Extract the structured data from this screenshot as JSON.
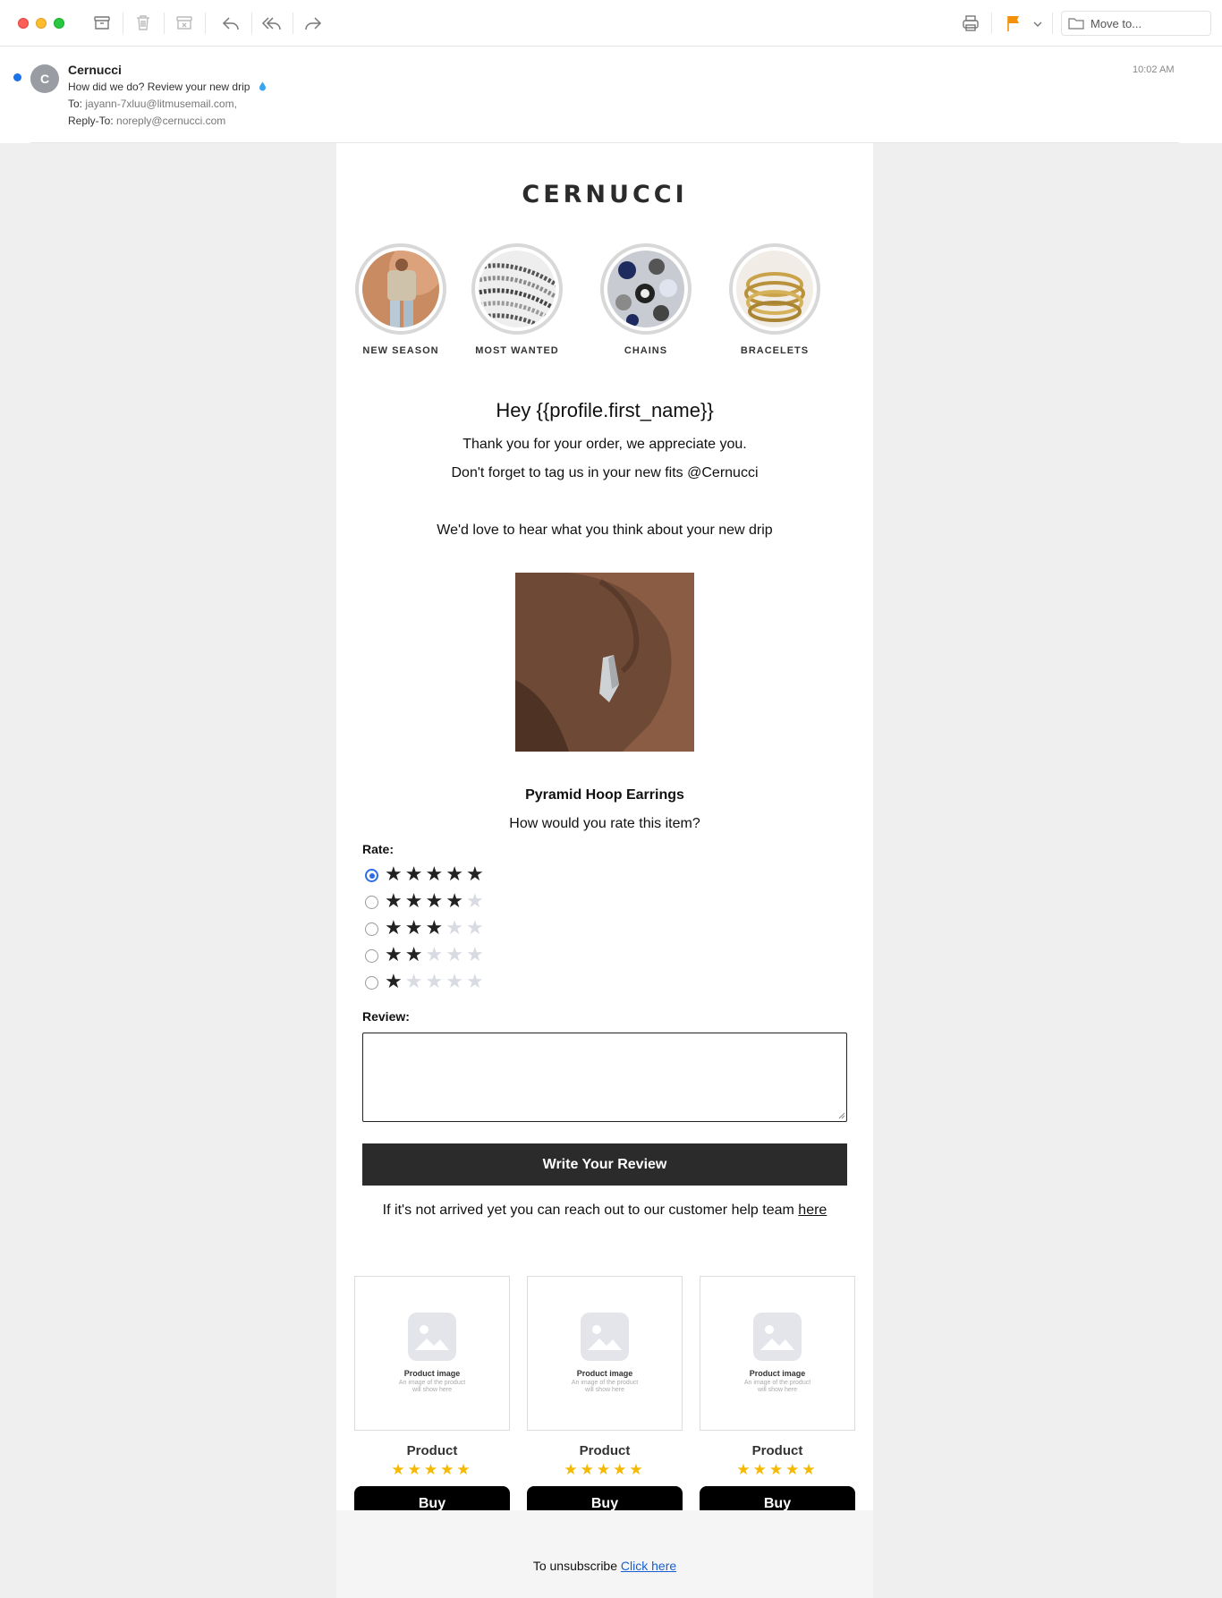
{
  "toolbar": {
    "move_to_label": "Move to...",
    "icons": [
      "archive-icon",
      "trash-icon",
      "junk-icon",
      "reply-icon",
      "reply-all-icon",
      "forward-icon",
      "print-icon",
      "flag-icon",
      "chevron-down-icon",
      "folder-icon"
    ],
    "flag_color": "#f5900b"
  },
  "message": {
    "avatar_initial": "C",
    "sender": "Cernucci",
    "subject": "How did we do? Review your new drip",
    "to_label": "To:",
    "to_value": "jayann-7xluu@litmusemail.com,",
    "reply_to_label": "Reply-To:",
    "reply_to_value": "noreply@cernucci.com",
    "time": "10:02 AM",
    "unread_color": "#1a73e8"
  },
  "email": {
    "brand": "CERNUCCI",
    "categories": [
      {
        "label": "NEW SEASON"
      },
      {
        "label": "MOST WANTED"
      },
      {
        "label": "CHAINS"
      },
      {
        "label": "BRACELETS"
      }
    ],
    "greeting": "Hey {{profile.first_name}}",
    "thanks": "Thank you for your order, we appreciate you.",
    "tag_line": "Don't forget to tag us in your new fits @Cernucci",
    "love_line": "We'd love to hear what you think about your new drip",
    "product_name": "Pyramid Hoop Earrings",
    "rate_question": "How would you rate this item?",
    "rate_label": "Rate:",
    "rating_options": [
      {
        "stars": 5,
        "selected": true
      },
      {
        "stars": 4,
        "selected": false
      },
      {
        "stars": 3,
        "selected": false
      },
      {
        "stars": 2,
        "selected": false
      },
      {
        "stars": 1,
        "selected": false
      }
    ],
    "review_label": "Review:",
    "review_value": "",
    "write_button": "Write Your Review",
    "help_text": "If it's not arrived yet you can reach out to our customer help team ",
    "help_link": "here",
    "recommendations": [
      {
        "ph_title": "Product image",
        "ph_sub": "An image of the product will show here",
        "name": "Product",
        "rating": 5,
        "buy": "Buy"
      },
      {
        "ph_title": "Product image",
        "ph_sub": "An image of the product will show here",
        "name": "Product",
        "rating": 5,
        "buy": "Buy"
      },
      {
        "ph_title": "Product image",
        "ph_sub": "An image of the product will show here",
        "name": "Product",
        "rating": 5,
        "buy": "Buy"
      }
    ],
    "unsubscribe_text": "To unsubscribe ",
    "unsubscribe_link": "Click here",
    "accent_color": "#2b2b2b",
    "star_color": "#f5b900",
    "link_color": "#1a5fd1"
  }
}
